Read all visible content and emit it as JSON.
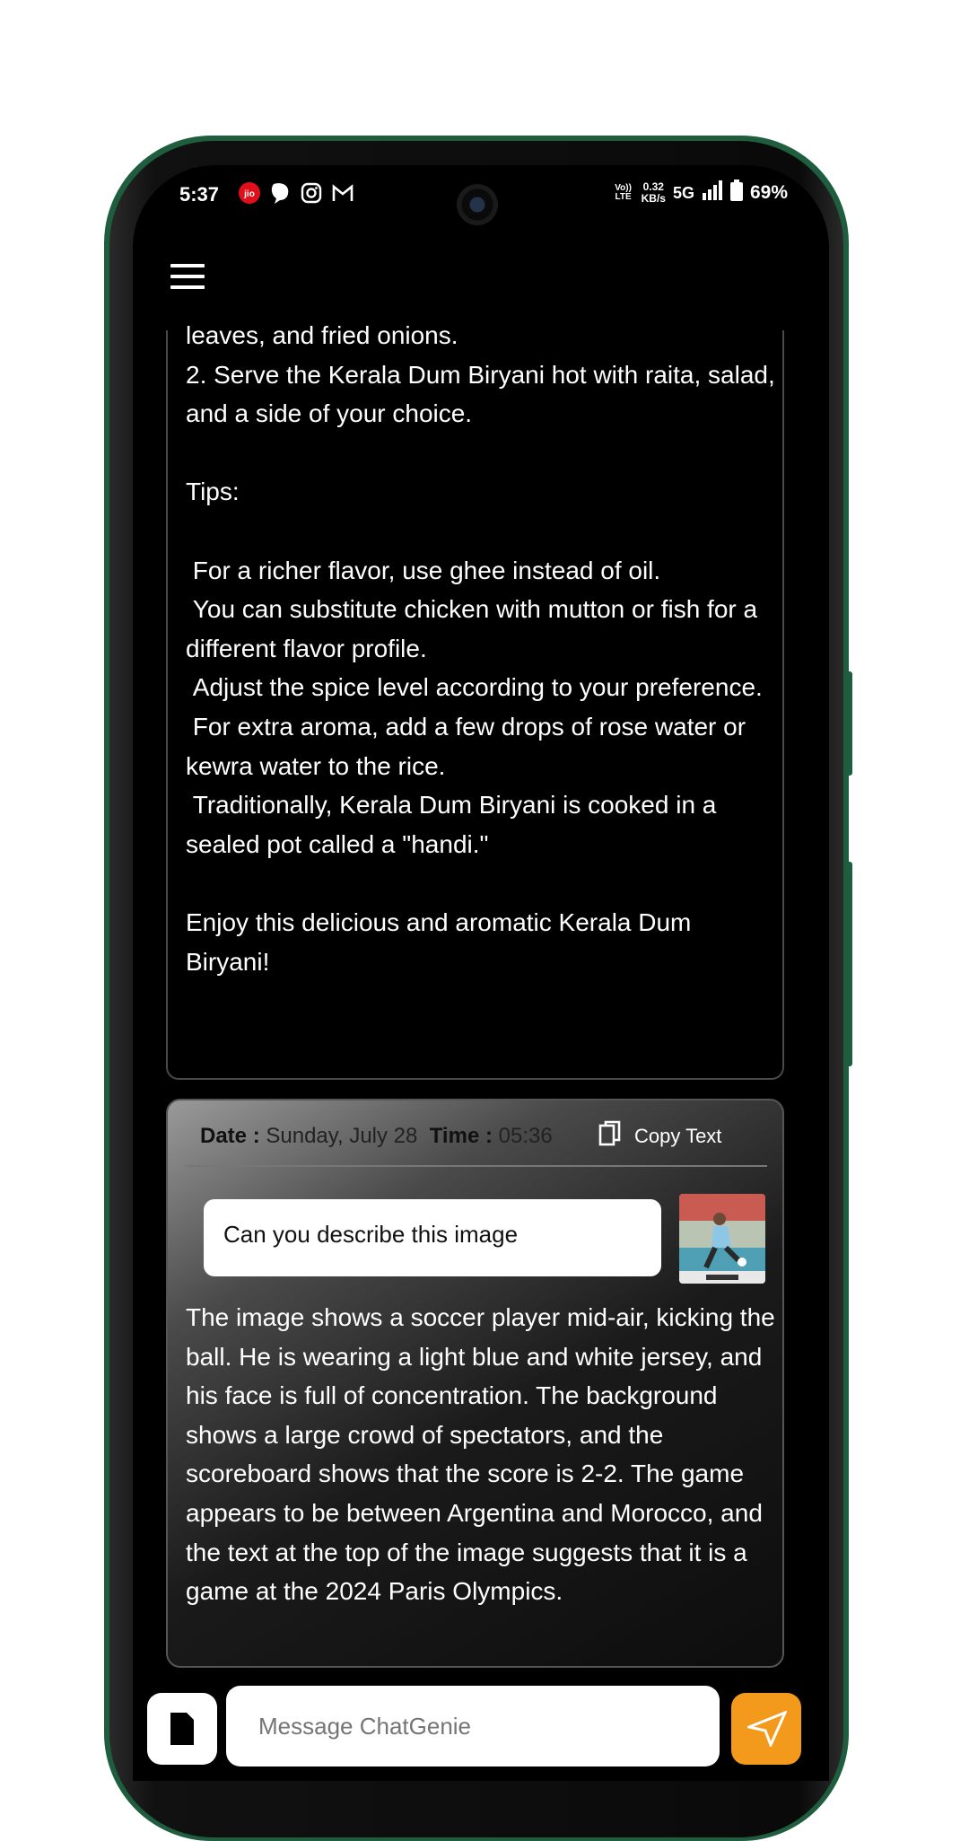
{
  "status_bar": {
    "time": "5:37",
    "left_icons": [
      "jio-icon",
      "chat-bubble-icon",
      "instagram-icon",
      "gmail-icon"
    ],
    "volte": "Vo)) LTE",
    "net_speed_value": "0.32",
    "net_speed_unit": "KB/s",
    "network": "5G",
    "battery": "69%"
  },
  "header": {
    "menu_icon": "hamburger-menu-icon"
  },
  "messages": [
    {
      "response": "leaves, and fried onions.\n2. Serve the Kerala Dum Biryani hot with raita, salad, and a side of your choice.\n\nTips:\n\n For a richer flavor, use ghee instead of oil.\n You can substitute chicken with mutton or fish for a different flavor profile.\n Adjust the spice level according to your preference.\n For extra aroma, add a few drops of rose water or kewra water to the rice.\n Traditionally, Kerala Dum Biryani is cooked in a sealed pot called a \"handi.\"\n\nEnjoy this delicious and aromatic Kerala Dum Biryani!"
    },
    {
      "date_label": "Date :",
      "date_value": "Sunday, July 28",
      "time_label": "Time :",
      "time_value": "05:36",
      "copy_label": "Copy Text",
      "prompt": "Can you describe this image",
      "response": "The image shows a soccer player mid-air, kicking the ball. He is wearing a light blue and white jersey, and his face is full of concentration. The background shows a large crowd of spectators, and the scoreboard shows that the score is 2-2. The game appears to be between Argentina and Morocco, and the text at the top of the image suggests that it is a game at the 2024 Paris Olympics."
    }
  ],
  "composer": {
    "placeholder": "Message ChatGenie",
    "accent_color": "#f39a1c"
  }
}
